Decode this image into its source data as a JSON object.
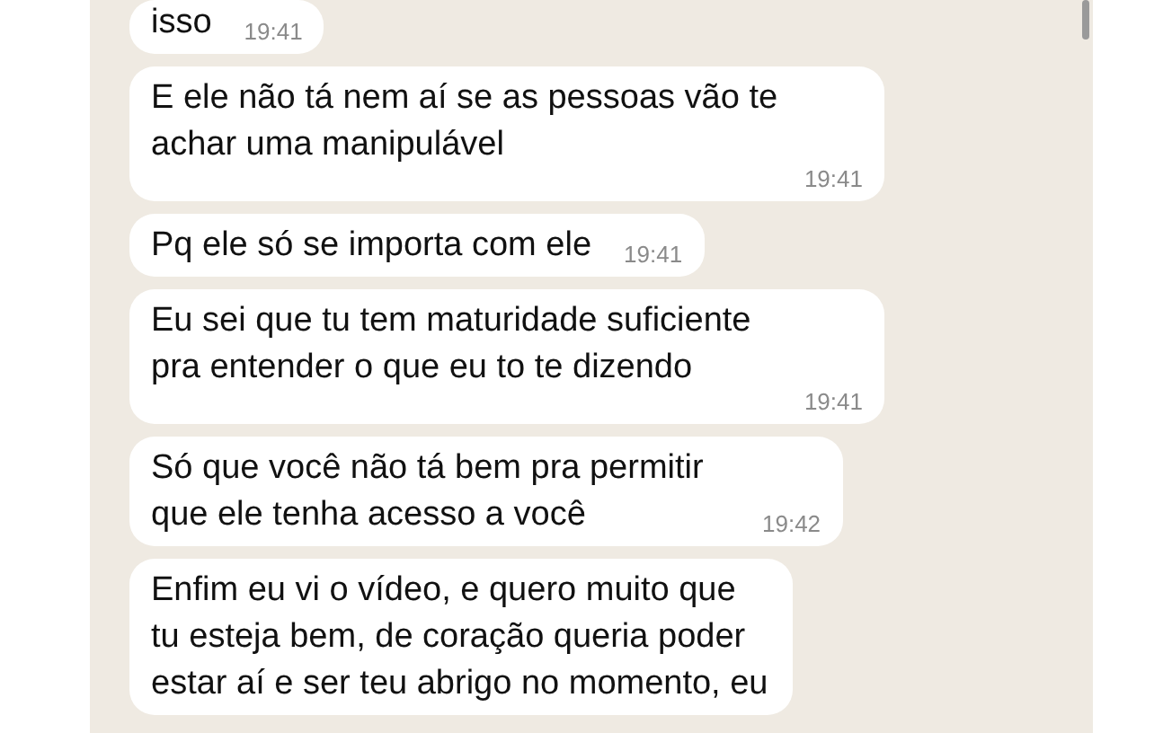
{
  "messages": [
    {
      "text": "isso",
      "time": "19:41"
    },
    {
      "text": "E ele não tá nem aí se as pessoas vão te achar uma manipulável",
      "time": "19:41"
    },
    {
      "text": "Pq ele só se importa com ele",
      "time": "19:41"
    },
    {
      "text": "Eu sei que tu tem maturidade suficiente pra entender o que eu to te dizendo",
      "time": "19:41"
    },
    {
      "text": "Só que você não tá bem pra permitir que ele tenha acesso a você",
      "time": "19:42"
    },
    {
      "text": "Enfim eu vi o vídeo, e quero muito que tu esteja bem, de coração queria poder estar aí e ser teu abrigo no momento, eu"
    }
  ]
}
